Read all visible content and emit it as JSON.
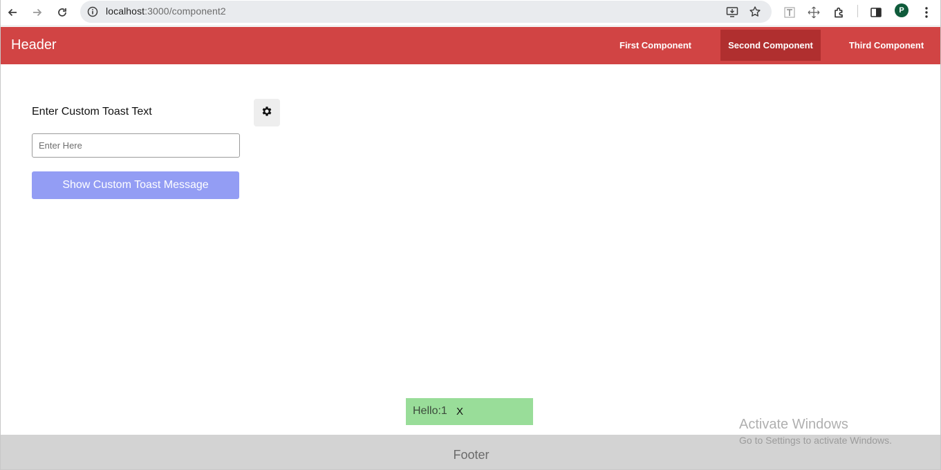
{
  "browser": {
    "url_host": "localhost",
    "url_path": ":3000/component2",
    "profile_initial": "P",
    "icons": [
      "back-arrow-icon",
      "forward-arrow-icon",
      "reload-icon",
      "info-icon",
      "install-app-icon",
      "bookmark-star-icon",
      "text-extension-icon",
      "move-extension-icon",
      "extensions-puzzle-icon",
      "side-panel-icon",
      "more-menu-icon"
    ]
  },
  "header": {
    "title": "Header",
    "nav": [
      {
        "label": "First Component",
        "active": false
      },
      {
        "label": "Second Component",
        "active": true
      },
      {
        "label": "Third Component",
        "active": false
      }
    ],
    "color": "#d14444",
    "active_color": "#b02f2f"
  },
  "main": {
    "label": "Enter Custom Toast Text",
    "input_placeholder": "Enter Here",
    "input_value": "",
    "button_label": "Show Custom Toast Message",
    "button_color": "#939df4",
    "settings_icon": "gear-icon"
  },
  "toast": {
    "message": "Hello:1",
    "close_label": "X",
    "color": "#99dd99"
  },
  "footer": {
    "label": "Footer"
  },
  "watermark": {
    "title": "Activate Windows",
    "subtitle": "Go to Settings to activate Windows."
  }
}
